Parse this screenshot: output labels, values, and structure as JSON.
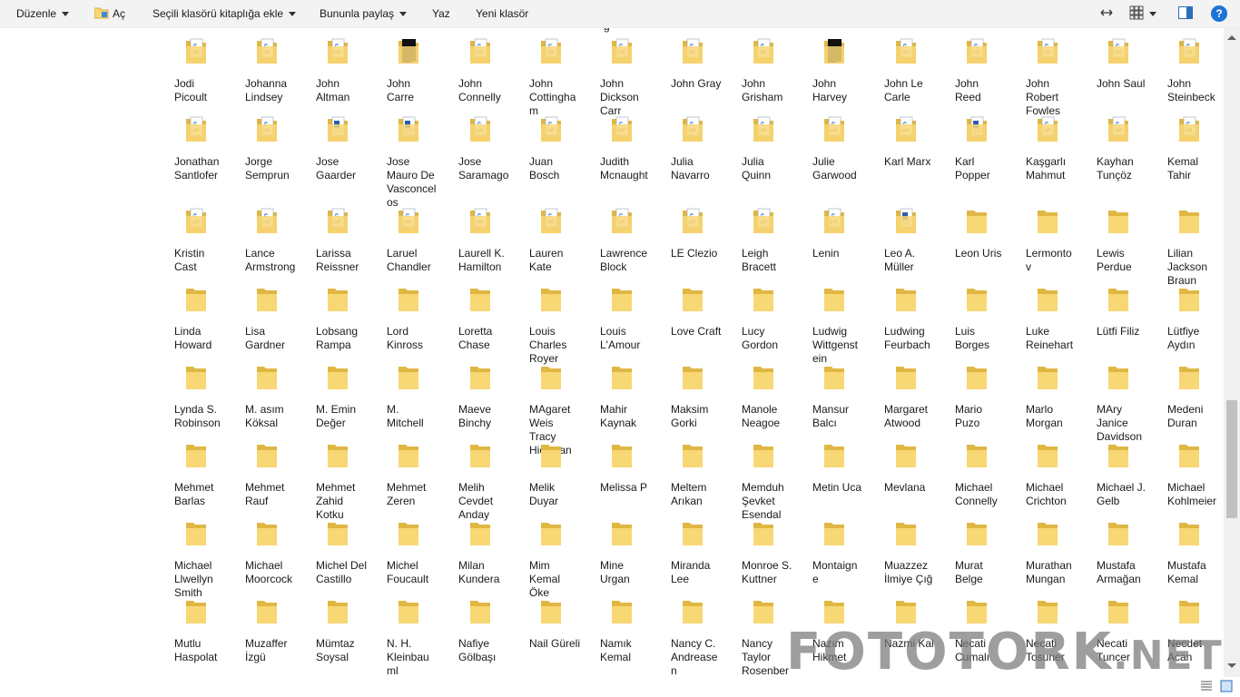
{
  "toolbar": {
    "edit_label": "Düzenle",
    "open_label": "Aç",
    "include_library_label": "Seçili klasörü kitaplığa ekle",
    "share_label": "Bununla paylaş",
    "write_label": "Yaz",
    "new_folder_label": "Yeni klasör",
    "help_label": "?"
  },
  "top_cut_text": "g",
  "rows": [
    [
      {
        "label": "Jodi Picoult",
        "icon": "pdf-folder-icon"
      },
      {
        "label": "Johanna Lindsey",
        "icon": "pdf-folder-icon"
      },
      {
        "label": "John Altman",
        "icon": "pdf-folder-icon"
      },
      {
        "label": "John Carre",
        "icon": "dark-folder-icon"
      },
      {
        "label": "John Connelly",
        "icon": "pdf-folder-icon"
      },
      {
        "label": "John Cottingham",
        "icon": "pdf-folder-icon"
      },
      {
        "label": "John Dickson Carr",
        "icon": "pdf-folder-icon"
      },
      {
        "label": "John Gray",
        "icon": "pdf-folder-icon"
      },
      {
        "label": "John Grisham",
        "icon": "pdf-folder-icon"
      },
      {
        "label": "John Harvey",
        "icon": "dark-folder-icon"
      },
      {
        "label": "John Le Carle",
        "icon": "pdf-folder-icon"
      },
      {
        "label": "John Reed",
        "icon": "pdf-folder-icon"
      },
      {
        "label": "John Robert Fowles",
        "icon": "pdf-folder-icon"
      },
      {
        "label": "John Saul",
        "icon": "pdf-folder-icon"
      },
      {
        "label": "John Steinbeck",
        "icon": "pdf-folder-icon"
      }
    ],
    [
      {
        "label": "Jonathan Santlofer",
        "icon": "pdf-folder-icon"
      },
      {
        "label": "Jorge Semprun",
        "icon": "pdf-folder-icon"
      },
      {
        "label": "Jose Gaarder",
        "icon": "doc-folder-icon"
      },
      {
        "label": "Jose Mauro De Vasconcelos",
        "icon": "doc-folder-icon"
      },
      {
        "label": "Jose Saramago",
        "icon": "pdf-folder-icon"
      },
      {
        "label": "Juan Bosch",
        "icon": "pdf-folder-icon"
      },
      {
        "label": "Judith Mcnaught",
        "icon": "pdf-folder-icon"
      },
      {
        "label": "Julia Navarro",
        "icon": "pdf-folder-icon"
      },
      {
        "label": "Julia Quinn",
        "icon": "pdf-folder-icon"
      },
      {
        "label": "Julie Garwood",
        "icon": "pdf-folder-icon"
      },
      {
        "label": "Karl Marx",
        "icon": "pdf-folder-icon"
      },
      {
        "label": "Karl Popper",
        "icon": "doc-folder-icon"
      },
      {
        "label": "Kaşgarlı Mahmut",
        "icon": "pdf-folder-icon"
      },
      {
        "label": "Kayhan Tunçöz",
        "icon": "pdf-folder-icon"
      },
      {
        "label": "Kemal Tahir",
        "icon": "pdf-folder-icon"
      }
    ],
    [
      {
        "label": "Kristin Cast",
        "icon": "pdf-folder-icon"
      },
      {
        "label": "Lance Armstrong",
        "icon": "pdf-folder-icon"
      },
      {
        "label": "Larissa Reissner",
        "icon": "pdf-folder-icon"
      },
      {
        "label": "Laruel Chandler",
        "icon": "pdf-folder-icon"
      },
      {
        "label": "Laurell K. Hamilton",
        "icon": "pdf-folder-icon"
      },
      {
        "label": "Lauren Kate",
        "icon": "pdf-folder-icon"
      },
      {
        "label": "Lawrence Block",
        "icon": "pdf-folder-icon"
      },
      {
        "label": "LE Clezio",
        "icon": "pdf-folder-icon"
      },
      {
        "label": "Leigh Bracett",
        "icon": "pdf-folder-icon"
      },
      {
        "label": "Lenin",
        "icon": "pdf-folder-icon"
      },
      {
        "label": "Leo A. Müller",
        "icon": "doc-folder-icon"
      },
      {
        "label": "Leon Uris",
        "icon": "folder-icon"
      },
      {
        "label": "Lermontov",
        "icon": "folder-icon"
      },
      {
        "label": "Lewis Perdue",
        "icon": "folder-icon"
      },
      {
        "label": "Lilian Jackson Braun",
        "icon": "folder-icon"
      }
    ],
    [
      {
        "label": "Linda Howard",
        "icon": "folder-icon"
      },
      {
        "label": "Lisa Gardner",
        "icon": "folder-icon"
      },
      {
        "label": "Lobsang Rampa",
        "icon": "folder-icon"
      },
      {
        "label": "Lord Kinross",
        "icon": "folder-icon"
      },
      {
        "label": "Loretta Chase",
        "icon": "folder-icon"
      },
      {
        "label": "Louis Charles Royer",
        "icon": "folder-icon"
      },
      {
        "label": "Louis L'Amour",
        "icon": "folder-icon"
      },
      {
        "label": "Love Craft",
        "icon": "folder-icon"
      },
      {
        "label": "Lucy Gordon",
        "icon": "folder-icon"
      },
      {
        "label": "Ludwig Wittgenstein",
        "icon": "folder-icon"
      },
      {
        "label": "Ludwing Feurbach",
        "icon": "folder-icon"
      },
      {
        "label": "Luis Borges",
        "icon": "folder-icon"
      },
      {
        "label": "Luke Reinehart",
        "icon": "folder-icon"
      },
      {
        "label": "Lütfi Filiz",
        "icon": "folder-icon"
      },
      {
        "label": "Lütfiye Aydın",
        "icon": "folder-icon"
      }
    ],
    [
      {
        "label": "Lynda S. Robinson",
        "icon": "folder-icon"
      },
      {
        "label": "M. asım Köksal",
        "icon": "folder-icon"
      },
      {
        "label": "M. Emin Değer",
        "icon": "folder-icon"
      },
      {
        "label": "M. Mitchell",
        "icon": "folder-icon"
      },
      {
        "label": "Maeve Binchy",
        "icon": "folder-icon"
      },
      {
        "label": "MAgaret Weis  Tracy Hickman",
        "icon": "folder-icon"
      },
      {
        "label": "Mahir Kaynak",
        "icon": "folder-icon"
      },
      {
        "label": "Maksim Gorki",
        "icon": "folder-icon"
      },
      {
        "label": "Manole Neagoe",
        "icon": "folder-icon"
      },
      {
        "label": "Mansur Balcı",
        "icon": "folder-icon"
      },
      {
        "label": "Margaret Atwood",
        "icon": "folder-icon"
      },
      {
        "label": "Mario Puzo",
        "icon": "folder-icon"
      },
      {
        "label": "Marlo Morgan",
        "icon": "folder-icon"
      },
      {
        "label": "MAry Janice Davidson",
        "icon": "folder-icon"
      },
      {
        "label": "Medeni Duran",
        "icon": "folder-icon"
      }
    ],
    [
      {
        "label": "Mehmet Barlas",
        "icon": "folder-icon"
      },
      {
        "label": "Mehmet Rauf",
        "icon": "folder-icon"
      },
      {
        "label": "Mehmet Zahid Kotku",
        "icon": "folder-icon"
      },
      {
        "label": "Mehmet Zeren",
        "icon": "folder-icon"
      },
      {
        "label": "Melih Cevdet Anday",
        "icon": "folder-icon"
      },
      {
        "label": "Melik Duyar",
        "icon": "folder-icon"
      },
      {
        "label": "Melissa P",
        "icon": "folder-icon"
      },
      {
        "label": "Meltem Arıkan",
        "icon": "folder-icon"
      },
      {
        "label": "Memduh Şevket Esendal",
        "icon": "folder-icon"
      },
      {
        "label": "Metin Uca",
        "icon": "folder-icon"
      },
      {
        "label": "Mevlana",
        "icon": "folder-icon"
      },
      {
        "label": "Michael Connelly",
        "icon": "folder-icon"
      },
      {
        "label": "Michael Crichton",
        "icon": "folder-icon"
      },
      {
        "label": "Michael J. Gelb",
        "icon": "folder-icon"
      },
      {
        "label": "Michael Kohlmeier",
        "icon": "folder-icon"
      }
    ],
    [
      {
        "label": "Michael Llwellyn Smith",
        "icon": "folder-icon"
      },
      {
        "label": "Michael Moorcock",
        "icon": "folder-icon"
      },
      {
        "label": "Michel Del Castillo",
        "icon": "folder-icon"
      },
      {
        "label": "Michel Foucault",
        "icon": "folder-icon"
      },
      {
        "label": "Milan Kundera",
        "icon": "folder-icon"
      },
      {
        "label": "Mim Kemal Öke",
        "icon": "folder-icon"
      },
      {
        "label": "Mine Urgan",
        "icon": "folder-icon"
      },
      {
        "label": "Miranda Lee",
        "icon": "folder-icon"
      },
      {
        "label": "Monroe S. Kuttner",
        "icon": "folder-icon"
      },
      {
        "label": "Montaigne",
        "icon": "folder-icon"
      },
      {
        "label": "Muazzez İlmiye Çığ",
        "icon": "folder-icon"
      },
      {
        "label": "Murat Belge",
        "icon": "folder-icon"
      },
      {
        "label": "Murathan Mungan",
        "icon": "folder-icon"
      },
      {
        "label": "Mustafa Armağan",
        "icon": "folder-icon"
      },
      {
        "label": "Mustafa Kemal",
        "icon": "folder-icon"
      }
    ],
    [
      {
        "label": "Mutlu Haspolat",
        "icon": "folder-icon"
      },
      {
        "label": "Muzaffer İzgü",
        "icon": "folder-icon"
      },
      {
        "label": "Mümtaz Soysal",
        "icon": "folder-icon"
      },
      {
        "label": "N. H. Kleinbauml",
        "icon": "folder-icon"
      },
      {
        "label": "Nafiye Gölbaşı",
        "icon": "folder-icon"
      },
      {
        "label": "Nail Güreli",
        "icon": "folder-icon"
      },
      {
        "label": "Namık Kemal",
        "icon": "folder-icon"
      },
      {
        "label": "Nancy C. Andreasen",
        "icon": "folder-icon"
      },
      {
        "label": "Nancy Taylor Rosenberg",
        "icon": "folder-icon"
      },
      {
        "label": "Nazım Hikmet",
        "icon": "folder-icon"
      },
      {
        "label": "Nazmi Kal",
        "icon": "folder-icon"
      },
      {
        "label": "Necati Cumalı",
        "icon": "folder-icon"
      },
      {
        "label": "Necati Tosuner",
        "icon": "folder-icon"
      },
      {
        "label": "Necati Tuncer",
        "icon": "folder-icon"
      },
      {
        "label": "Necdet Acan",
        "icon": "folder-icon"
      }
    ]
  ],
  "watermark": {
    "main": "FOTOTORK",
    "suffix": ".NET"
  },
  "colors": {
    "folder": "#f8d775",
    "folder_dark": "#e0b743",
    "toolbar_bg": "#f3f3f3",
    "accent": "#1e73d6"
  }
}
